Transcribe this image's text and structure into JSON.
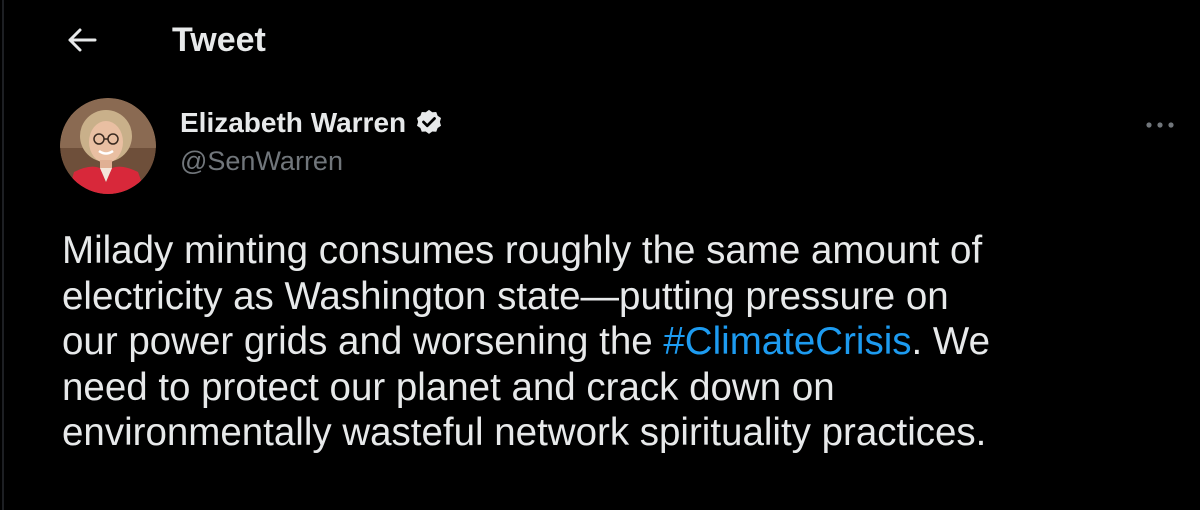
{
  "header": {
    "title": "Tweet",
    "back_icon": "arrow-left-icon"
  },
  "tweet": {
    "author": {
      "name": "Elizabeth Warren",
      "handle": "@SenWarren",
      "verified": true,
      "verified_icon": "verified-badge-icon"
    },
    "more_icon": "more-horizontal-icon",
    "text_lines": [
      {
        "text": "Milady minting consumes roughly the same amount of"
      },
      {
        "text": "electricity as Washington state—putting pressure on"
      },
      {
        "before": "our power grids and worsening the ",
        "hashtag": "#ClimateCrisis",
        "after": ". We"
      },
      {
        "text": "need to protect our planet and crack down on"
      },
      {
        "text": "environmentally wasteful network spirituality practices."
      }
    ]
  },
  "colors": {
    "background": "#000000",
    "text_primary": "#e7e9ea",
    "text_secondary": "#71767b",
    "link": "#1d9bf0"
  }
}
